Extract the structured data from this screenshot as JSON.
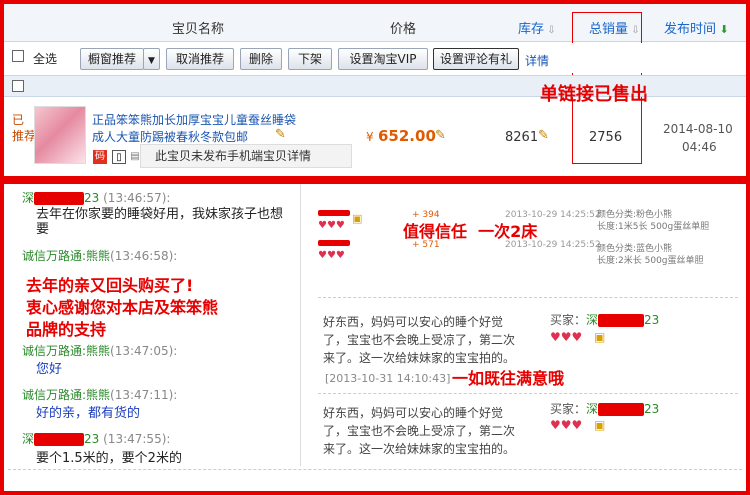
{
  "header": {
    "col_name": "宝贝名称",
    "col_price": "价格",
    "col_stock": "库存",
    "col_sales": "总销量",
    "col_publish": "发布时间"
  },
  "toolbar": {
    "select_all": "全选",
    "window_recommend": "橱窗推荐",
    "cancel_recommend": "取消推荐",
    "delete": "删除",
    "offline": "下架",
    "set_vip": "设置淘宝VIP",
    "set_comment_gift": "设置评论有礼",
    "details": "详情"
  },
  "annotation_sold_out": "单链接已售出",
  "item": {
    "recommend_tag_1": "已",
    "recommend_tag_2": "推荐",
    "title_line1": "正品笨笨熊加长加厚宝宝儿童蚕丝睡袋",
    "title_line2": "成人大童防踢被春秋冬款包邮",
    "price": "652.00",
    "price_symbol": "¥",
    "stock": "8261",
    "sales": "2756",
    "publish_date": "2014-08-10",
    "publish_time": "04:46",
    "mobile_notice": "此宝贝未发布手机端宝贝详情",
    "tag_icon_label": "码"
  },
  "chat": {
    "entries": [
      {
        "nick_suffix": "23",
        "time": "(13:46:57):",
        "text": "去年在你家要的睡袋好用，我妹家孩子也想要"
      },
      {
        "nick": "诚信万路通:熊熊",
        "time": "(13:46:58):",
        "text": ""
      },
      {
        "nick": "诚信万路通:熊熊",
        "time": "(13:47:05):",
        "text": "您好"
      },
      {
        "nick": "诚信万路通:熊熊",
        "time": "(13:47:11):",
        "text": "好的亲，都有货的"
      },
      {
        "nick_suffix": "23",
        "time": "(13:47:55):",
        "text": "要个1.5米的，要个2米的"
      }
    ],
    "overlay_line1": "去年的亲又回头购买了!",
    "overlay_line2": "衷心感谢您对本店及笨笨熊",
    "overlay_line3": "品牌的支持"
  },
  "reviews": {
    "trust_label": "值得信任  一次2床",
    "score1": "394",
    "score2": "571",
    "date1": "2013-10-29 14:25:52",
    "date2": "2013-10-29 14:25:52",
    "spec1_a": "颜色分类:粉色小熊",
    "spec1_b": "长度:1米5长 500g蛋丝单胆",
    "spec2_a": "颜色分类:蓝色小熊",
    "spec2_b": "长度:2米长 500g蛋丝单胆",
    "review1_text_1": "好东西，妈妈可以安心的睡个好觉",
    "review1_text_2": "了，宝宝也不会晚上受凉了，第二次",
    "review1_text_3": "来了。这一次给妹妹家的宝宝拍的。",
    "review1_time": "[2013-10-31 14:10:43]",
    "review2_text_1": "好东西，妈妈可以安心的睡个好觉",
    "review2_text_2": "了，宝宝也不会晚上受凉了，第二次",
    "review2_text_3": "来了。这一次给妹妹家的宝宝拍的。",
    "buyer_label": "买家：",
    "buyer_suffix": "23",
    "consistent_label": "一如既往满意哦"
  }
}
